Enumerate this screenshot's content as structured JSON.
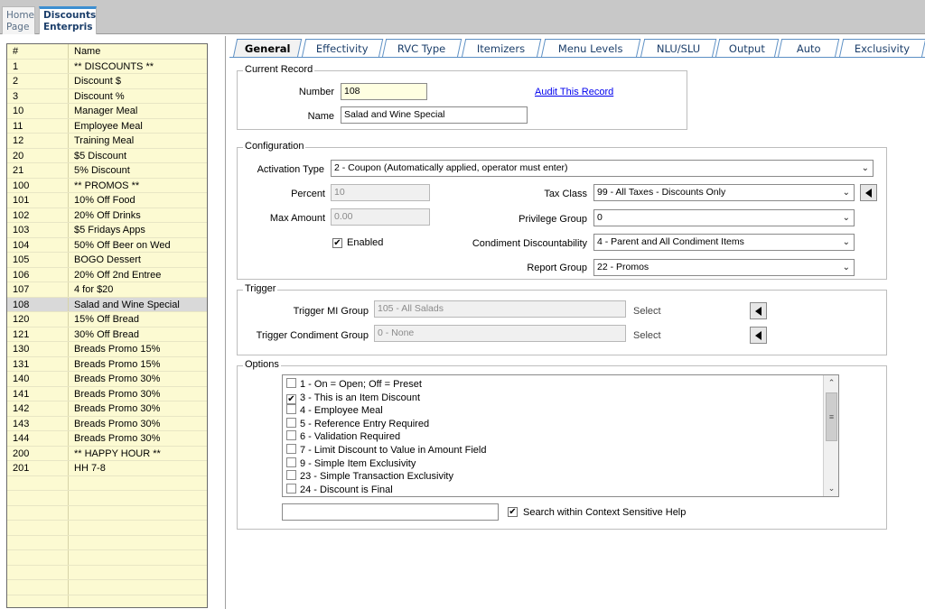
{
  "top_tabs": [
    {
      "line1": "Home",
      "line2": "Page"
    },
    {
      "line1": "Discounts",
      "line2": "Enterpris"
    }
  ],
  "grid": {
    "col_number": "#",
    "col_name": "Name",
    "rows": [
      {
        "number": "1",
        "name": "** DISCOUNTS **"
      },
      {
        "number": "2",
        "name": "Discount $"
      },
      {
        "number": "3",
        "name": "Discount %"
      },
      {
        "number": "10",
        "name": "Manager Meal"
      },
      {
        "number": "11",
        "name": "Employee Meal"
      },
      {
        "number": "12",
        "name": "Training Meal"
      },
      {
        "number": "20",
        "name": "$5 Discount"
      },
      {
        "number": "21",
        "name": "5% Discount"
      },
      {
        "number": "100",
        "name": "** PROMOS **"
      },
      {
        "number": "101",
        "name": "10% Off Food"
      },
      {
        "number": "102",
        "name": "20% Off Drinks"
      },
      {
        "number": "103",
        "name": "$5 Fridays Apps"
      },
      {
        "number": "104",
        "name": "50% Off Beer on Wed"
      },
      {
        "number": "105",
        "name": "BOGO Dessert"
      },
      {
        "number": "106",
        "name": "20% Off 2nd Entree"
      },
      {
        "number": "107",
        "name": "4 for $20"
      },
      {
        "number": "108",
        "name": "Salad and Wine Special"
      },
      {
        "number": "120",
        "name": "15% Off Bread"
      },
      {
        "number": "121",
        "name": "30% Off Bread"
      },
      {
        "number": "130",
        "name": "Breads Promo 15%"
      },
      {
        "number": "131",
        "name": "Breads Promo 15%"
      },
      {
        "number": "140",
        "name": "Breads Promo 30%"
      },
      {
        "number": "141",
        "name": "Breads Promo 30%"
      },
      {
        "number": "142",
        "name": "Breads Promo 30%"
      },
      {
        "number": "143",
        "name": "Breads Promo 30%"
      },
      {
        "number": "144",
        "name": "Breads Promo 30%"
      },
      {
        "number": "200",
        "name": "** HAPPY HOUR **"
      },
      {
        "number": "201",
        "name": "HH 7-8"
      }
    ],
    "selected_number": "108"
  },
  "tabs": [
    "General",
    "Effectivity",
    "RVC Type",
    "Itemizers",
    "Menu Levels",
    "NLU/SLU",
    "Output",
    "Auto",
    "Exclusivity"
  ],
  "current_record": {
    "legend": "Current Record",
    "number_label": "Number",
    "number_value": "108",
    "audit_link": "Audit This Record",
    "name_label": "Name",
    "name_value": "Salad and Wine Special"
  },
  "configuration": {
    "legend": "Configuration",
    "activation_type_label": "Activation Type",
    "activation_type_value": "2 - Coupon (Automatically applied, operator must enter)",
    "percent_label": "Percent",
    "percent_value": "10",
    "max_amount_label": "Max Amount",
    "max_amount_value": "0.00",
    "enabled_label": "Enabled",
    "enabled_checked": true,
    "tax_class_label": "Tax Class",
    "tax_class_value": "99 - All Taxes - Discounts Only",
    "privilege_group_label": "Privilege Group",
    "privilege_group_value": "0",
    "condiment_label": "Condiment Discountability",
    "condiment_value": "4 - Parent and All Condiment Items",
    "report_group_label": "Report Group",
    "report_group_value": "22 - Promos"
  },
  "trigger": {
    "legend": "Trigger",
    "mi_group_label": "Trigger MI Group",
    "mi_group_value": "105 - All Salads",
    "condiment_group_label": "Trigger Condiment Group",
    "condiment_group_value": "0 - None",
    "select_label": "Select"
  },
  "options": {
    "legend": "Options",
    "items": [
      {
        "label": "1 - On = Open; Off = Preset",
        "checked": false
      },
      {
        "label": "3 - This is an Item Discount",
        "checked": true
      },
      {
        "label": "4 - Employee Meal",
        "checked": false
      },
      {
        "label": "5 - Reference Entry Required",
        "checked": false
      },
      {
        "label": "6 - Validation Required",
        "checked": false
      },
      {
        "label": "7 - Limit Discount to Value in Amount Field",
        "checked": false
      },
      {
        "label": "9 - Simple Item Exclusivity",
        "checked": false
      },
      {
        "label": "23 - Simple Transaction Exclusivity",
        "checked": false
      },
      {
        "label": "24 - Discount is Final",
        "checked": false
      }
    ],
    "search_value": "",
    "search_help_label": "Search within Context Sensitive Help",
    "search_help_checked": true
  }
}
